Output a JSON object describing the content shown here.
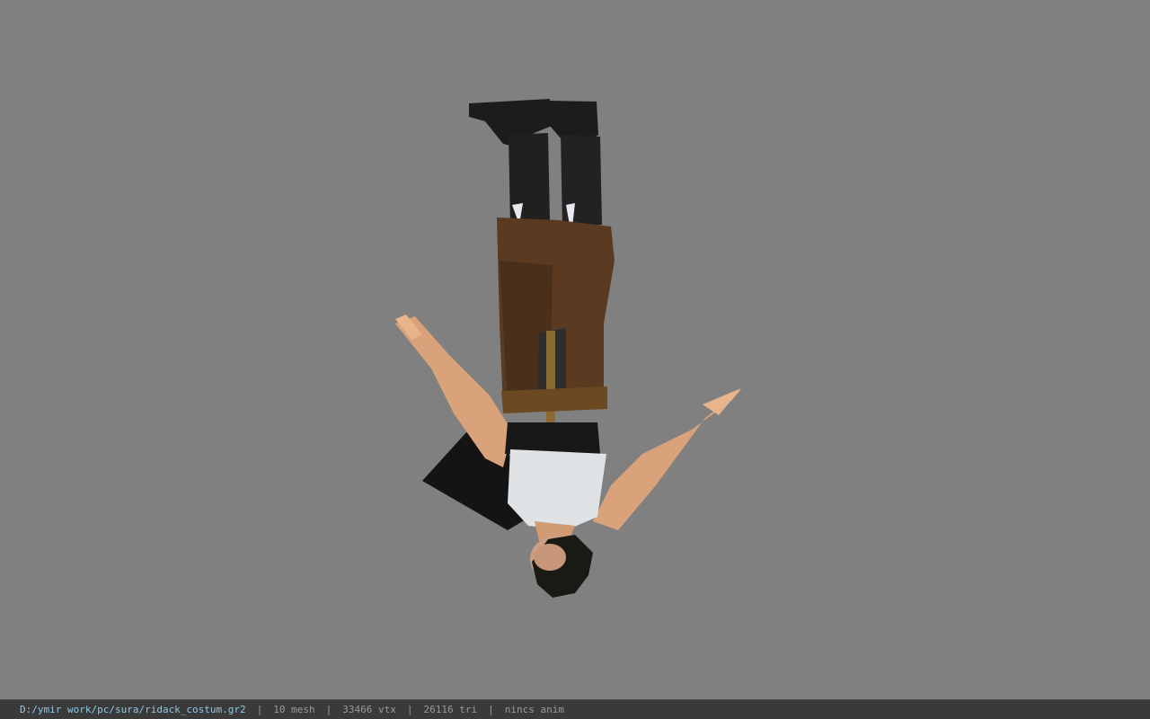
{
  "viewer": {
    "file_path": "D:/ymir work/pc/sura/ridack_costum.gr2",
    "mesh_count": "10 mesh",
    "vertex_count": "33466 vtx",
    "triangle_count": "26116 tri",
    "anim_status": "nincs anim",
    "separator": "|"
  },
  "colors": {
    "background": "#808080",
    "status_bar": "#3a3a3a",
    "path_text": "#8ec9e6",
    "info_text": "#9a9a9a"
  }
}
